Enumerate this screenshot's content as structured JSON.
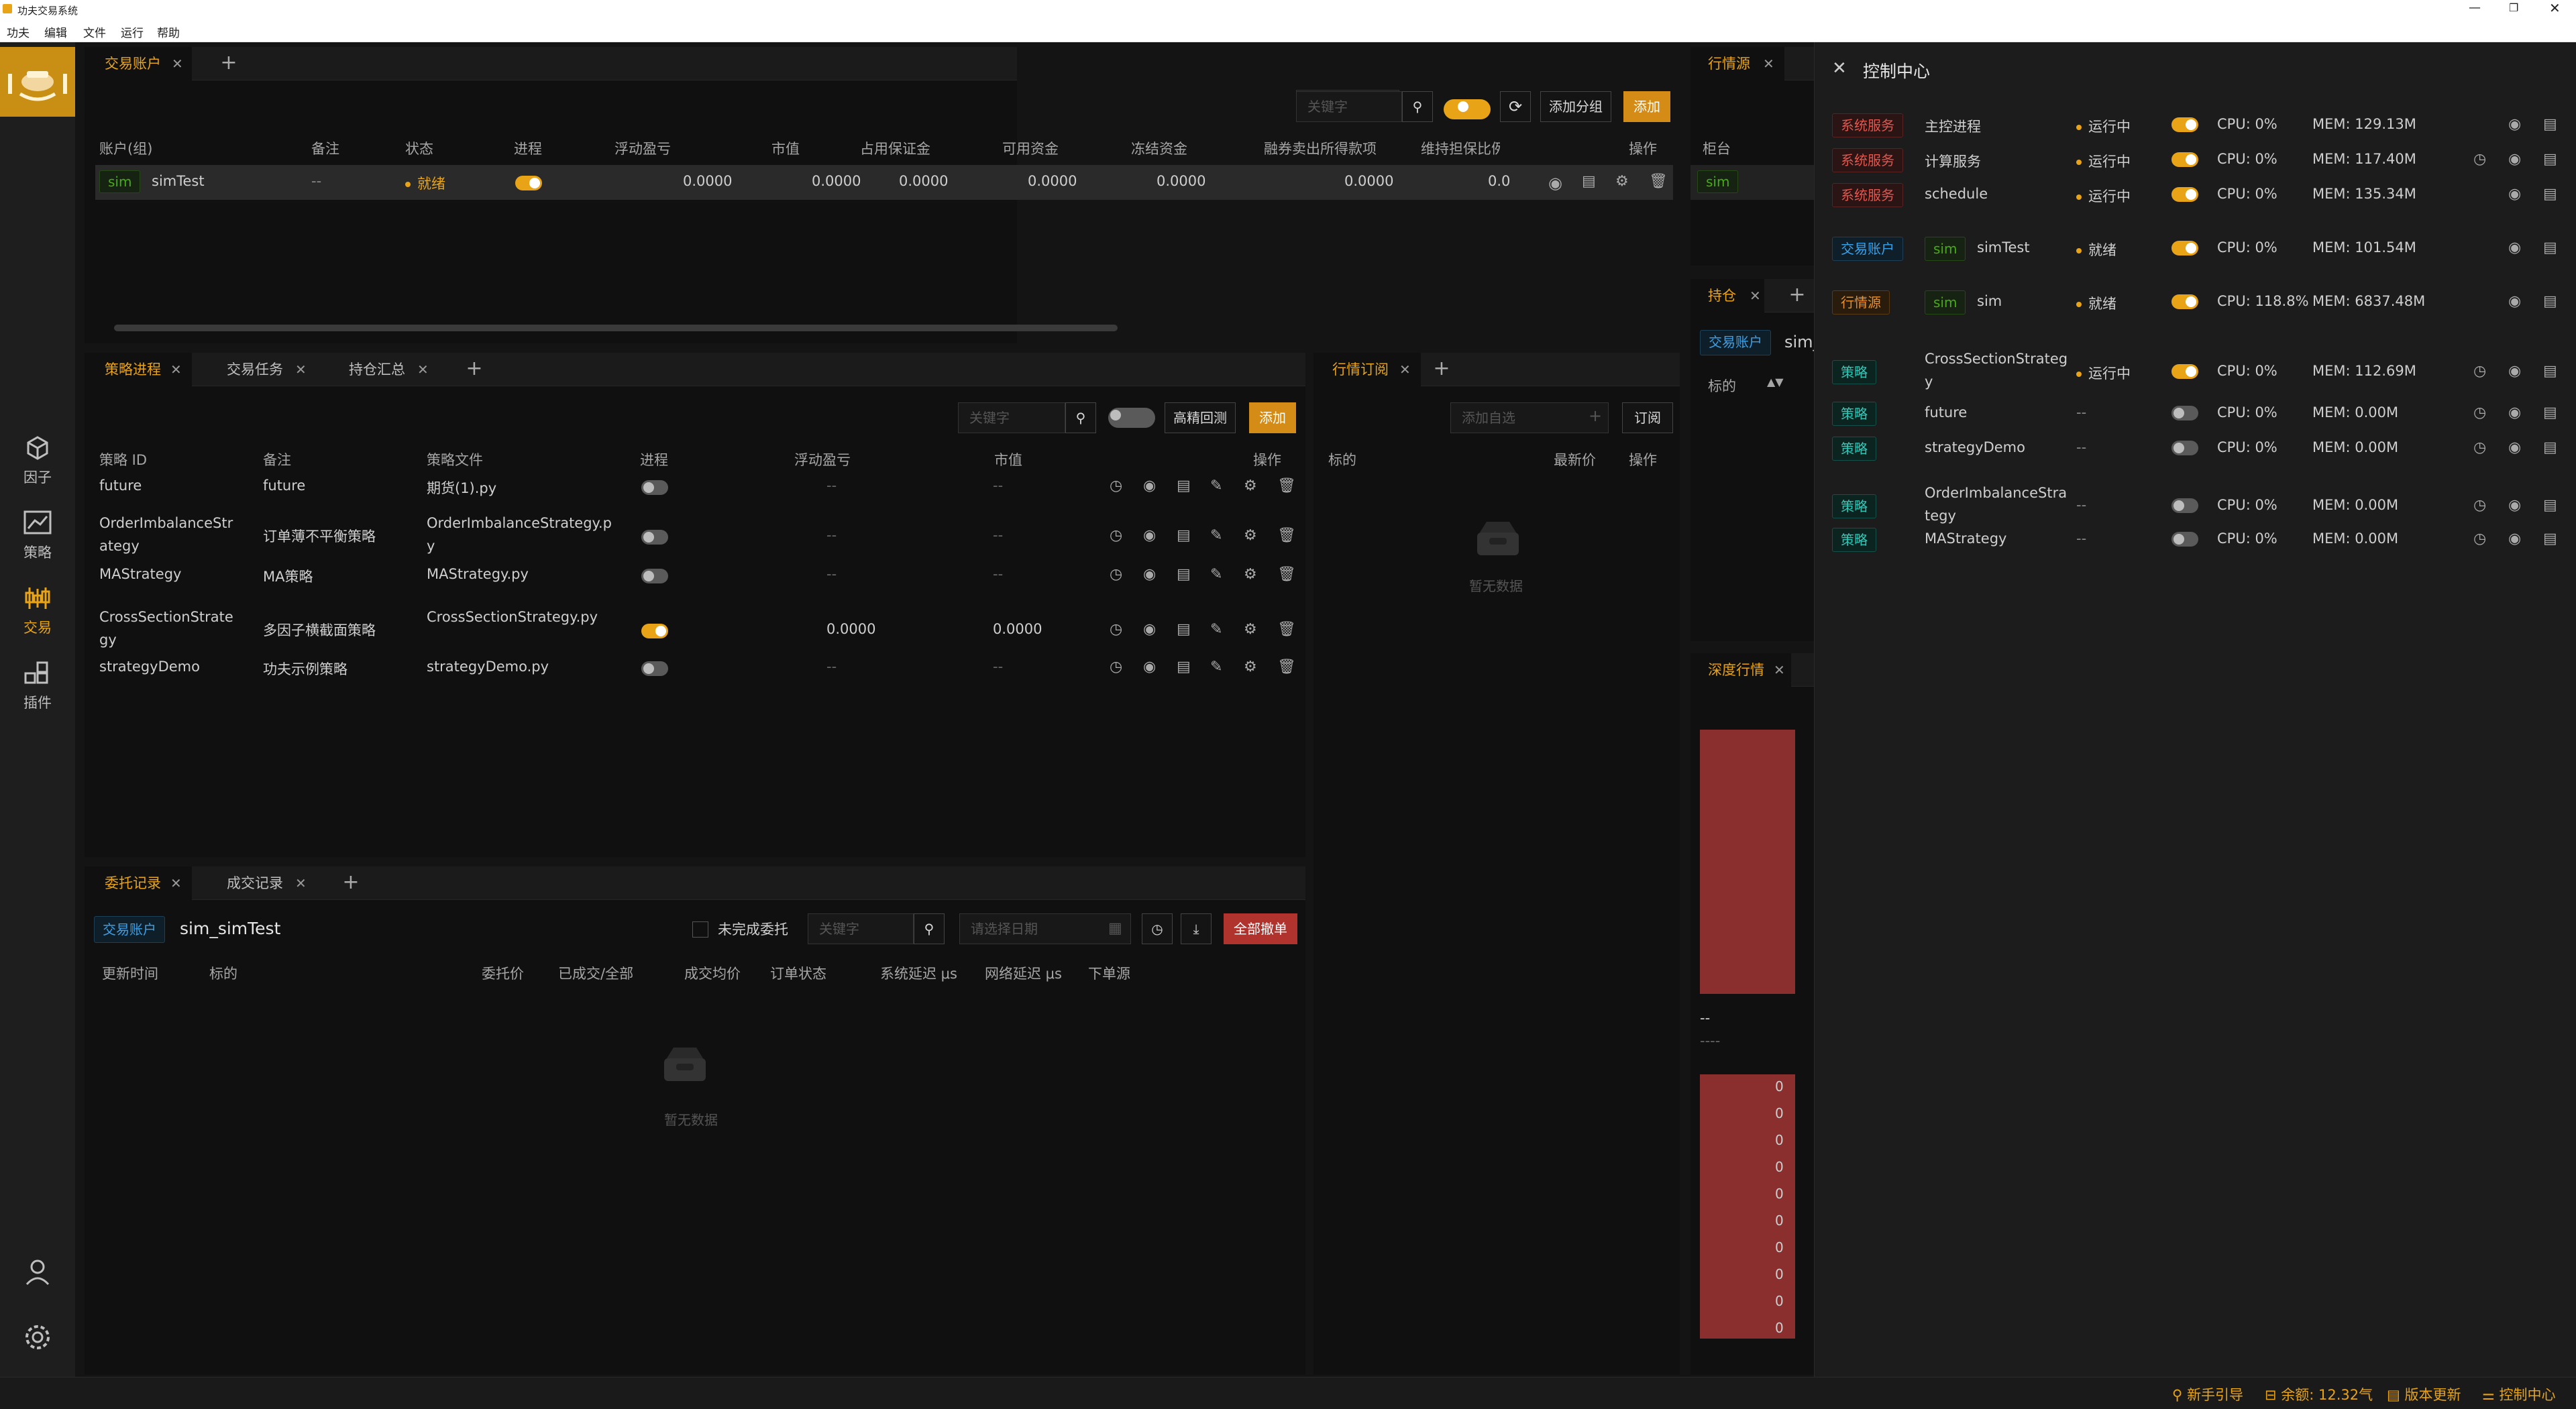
{
  "window": {
    "title": "功夫交易系统"
  },
  "menu": [
    "功夫",
    "编辑",
    "文件",
    "运行",
    "帮助"
  ],
  "sidebar": {
    "items": [
      {
        "label": "因子",
        "icon": "cube-icon"
      },
      {
        "label": "策略",
        "icon": "chart-line-icon"
      },
      {
        "label": "交易",
        "icon": "candlestick-icon"
      },
      {
        "label": "插件",
        "icon": "plugin-icon"
      }
    ]
  },
  "accounts": {
    "tab": "交易账户",
    "search_placeholder": "关键字",
    "add_group": "添加分组",
    "add": "添加",
    "columns": [
      "账户(组)",
      "备注",
      "状态",
      "进程",
      "浮动盈亏",
      "市值",
      "占用保证金",
      "可用资金",
      "冻结资金",
      "融券卖出所得款项",
      "维持担保比例",
      "操作"
    ],
    "rows": [
      {
        "tag": "sim",
        "name": "simTest",
        "remark": "--",
        "status": "就绪",
        "pnl": "0.0000",
        "mv": "0.0000",
        "margin": "0.0000",
        "avail": "0.0000",
        "frozen": "0.0000",
        "short_proceeds": "0.0000",
        "maint": "0.0"
      }
    ]
  },
  "md_source": {
    "tab": "行情源",
    "col": "柜台",
    "row_tag": "sim"
  },
  "positions": {
    "tab": "持仓",
    "acct_tag": "交易账户",
    "acct_name": "sim_",
    "col": "标的"
  },
  "depth": {
    "tab": "深度行情",
    "mid1": "--",
    "mid2": "----",
    "bids": [
      "0",
      "0",
      "0",
      "0",
      "0",
      "0",
      "0",
      "0",
      "0",
      "0"
    ]
  },
  "strategy": {
    "tabs": [
      "策略进程",
      "交易任务",
      "持仓汇总"
    ],
    "search_placeholder": "关键字",
    "backtest": "高精回测",
    "add": "添加",
    "columns": [
      "策略 ID",
      "备注",
      "策略文件",
      "进程",
      "浮动盈亏",
      "市值",
      "操作"
    ],
    "rows": [
      {
        "id": "future",
        "remark": "future",
        "file": "期货(1).py",
        "on": false,
        "pnl": "--",
        "mv": "--"
      },
      {
        "id": "OrderImbalanceStr",
        "id2": "ategy",
        "remark": "订单薄不平衡策略",
        "file": "OrderImbalanceStrategy.p",
        "file2": "y",
        "on": false,
        "pnl": "--",
        "mv": "--"
      },
      {
        "id": "MAStrategy",
        "remark": "MA策略",
        "file": "MAStrategy.py",
        "on": false,
        "pnl": "--",
        "mv": "--"
      },
      {
        "id": "CrossSectionStrate",
        "id2": "gy",
        "remark": "多因子横截面策略",
        "file": "CrossSectionStrategy.py",
        "on": true,
        "pnl": "0.0000",
        "mv": "0.0000"
      },
      {
        "id": "strategyDemo",
        "remark": "功夫示例策略",
        "file": "strategyDemo.py",
        "on": false,
        "pnl": "--",
        "mv": "--"
      }
    ]
  },
  "market_sub": {
    "tab": "行情订阅",
    "placeholder": "添加自选",
    "subscribe": "订阅",
    "columns": [
      "标的",
      "最新价",
      "操作"
    ],
    "empty": "暂无数据"
  },
  "orders": {
    "tabs": [
      "委托记录",
      "成交记录"
    ],
    "acct_tag": "交易账户",
    "acct_name": "sim_simTest",
    "unfinished": "未完成委托",
    "search_placeholder": "关键字",
    "date_placeholder": "请选择日期",
    "cancel_all": "全部撤单",
    "columns": [
      "更新时间",
      "标的",
      "委托价",
      "已成交/全部",
      "成交均价",
      "订单状态",
      "系统延迟 μs",
      "网络延迟 μs",
      "下单源"
    ],
    "empty": "暂无数据"
  },
  "control_center": {
    "title": "控制中心",
    "rows": [
      {
        "tag": "系统服务",
        "tag_color": "red",
        "name": "主控进程",
        "status": "运行中",
        "on": true,
        "cpu": "CPU: 0%",
        "mem": "MEM: 129.13M",
        "clock": false
      },
      {
        "tag": "系统服务",
        "tag_color": "red",
        "name": "计算服务",
        "status": "运行中",
        "on": true,
        "cpu": "CPU: 0%",
        "mem": "MEM: 117.40M",
        "clock": true
      },
      {
        "tag": "系统服务",
        "tag_color": "red",
        "name": "schedule",
        "status": "运行中",
        "on": true,
        "cpu": "CPU: 0%",
        "mem": "MEM: 135.34M",
        "clock": false
      },
      {
        "tag": "交易账户",
        "tag_color": "blue",
        "sim": "sim",
        "name": "simTest",
        "status": "就绪",
        "on": true,
        "cpu": "CPU: 0%",
        "mem": "MEM: 101.54M",
        "clock": false
      },
      {
        "tag": "行情源",
        "tag_color": "orange",
        "sim": "sim",
        "name": "sim",
        "status": "就绪",
        "on": true,
        "cpu": "CPU: 118.8%",
        "mem": "MEM: 6837.48M",
        "clock": false
      },
      {
        "tag": "策略",
        "tag_color": "cyan",
        "name": "CrossSectionStrateg",
        "name2": "y",
        "status": "运行中",
        "on": true,
        "cpu": "CPU: 0%",
        "mem": "MEM: 112.69M",
        "clock": true
      },
      {
        "tag": "策略",
        "tag_color": "cyan",
        "name": "future",
        "status": "--",
        "on": false,
        "cpu": "CPU: 0%",
        "mem": "MEM: 0.00M",
        "clock": true
      },
      {
        "tag": "策略",
        "tag_color": "cyan",
        "name": "strategyDemo",
        "status": "--",
        "on": false,
        "cpu": "CPU: 0%",
        "mem": "MEM: 0.00M",
        "clock": true
      },
      {
        "tag": "策略",
        "tag_color": "cyan",
        "name": "OrderImbalanceStra",
        "name2": "tegy",
        "status": "--",
        "on": false,
        "cpu": "CPU: 0%",
        "mem": "MEM: 0.00M",
        "clock": true
      },
      {
        "tag": "策略",
        "tag_color": "cyan",
        "name": "MAStrategy",
        "status": "--",
        "on": false,
        "cpu": "CPU: 0%",
        "mem": "MEM: 0.00M",
        "clock": true
      }
    ]
  },
  "statusbar": {
    "guide": "新手引导",
    "balance": "余额: 12.32气",
    "update": "版本更新",
    "control": "控制中心"
  },
  "colors": {
    "accent": "#e8a317",
    "danger": "#b0332e"
  }
}
